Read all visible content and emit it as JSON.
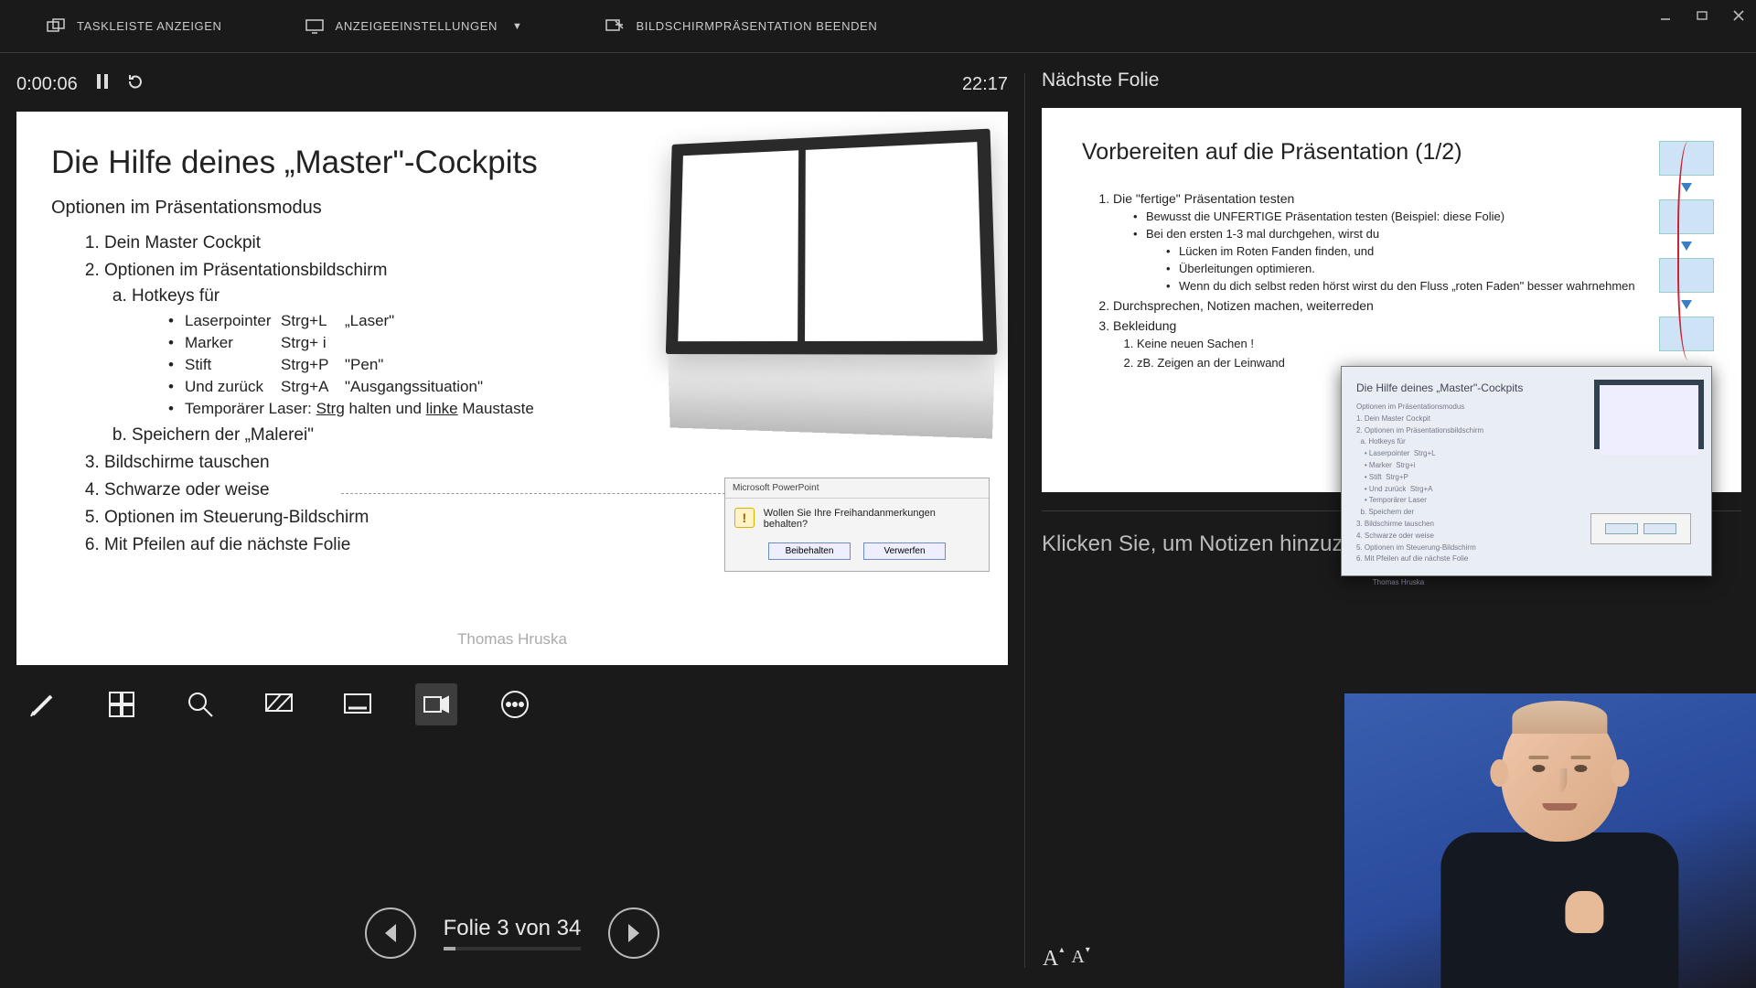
{
  "window": {
    "minimize": "—",
    "maximize": "❐",
    "close": "✕"
  },
  "topbar": {
    "taskbar": "TASKLEISTE ANZEIGEN",
    "display": "ANZEIGEEINSTELLUNGEN",
    "display_caret": "▼",
    "end": "BILDSCHIRMPRÄSENTATION BEENDEN"
  },
  "timer": {
    "elapsed": "0:00:06",
    "clock": "22:17"
  },
  "current_slide": {
    "title": "Die Hilfe deines „Master\"-Cockpits",
    "subtitle": "Optionen im Präsentationsmodus",
    "items": {
      "1": "Dein Master Cockpit",
      "2": "Optionen im Präsentationsbildschirm",
      "2a": "Hotkeys für",
      "hk1_a": "Laserpointer",
      "hk1_b": "Strg+L",
      "hk1_c": "„Laser\"",
      "hk2_a": "Marker",
      "hk2_b": "Strg+ i",
      "hk2_c": "",
      "hk3_a": "Stift",
      "hk3_b": "Strg+P",
      "hk3_c": "\"Pen\"",
      "hk4_a": "Und zurück",
      "hk4_b": "Strg+A",
      "hk4_c": "\"Ausgangssituation\"",
      "hk5_pre": "Temporärer Laser:  ",
      "hk5_u1": "Strg",
      "hk5_mid": " halten und ",
      "hk5_u2": "linke",
      "hk5_post": " Maustaste",
      "2b": "Speichern der „Malerei\"",
      "3": "Bildschirme tauschen",
      "4": "Schwarze oder weise",
      "5": "Optionen im Steuerung-Bildschirm",
      "6": "Mit Pfeilen auf die nächste Folie"
    },
    "author": "Thomas Hruska",
    "dialog": {
      "title": "Microsoft PowerPoint",
      "text": "Wollen Sie Ihre Freihandanmerkungen behalten?",
      "keep": "Beibehalten",
      "discard": "Verwerfen"
    }
  },
  "nav": {
    "label": "Folie 3 von 34",
    "current": 3,
    "total": 34
  },
  "next": {
    "label": "Nächste Folie",
    "title": "Vorbereiten auf die Präsentation (1/2)",
    "i1": "Die \"fertige\" Präsentation testen",
    "i1a": "Bewusst die UNFERTIGE Präsentation testen (Beispiel: diese Folie)",
    "i1b": "Bei den ersten 1-3 mal durchgehen, wirst du",
    "i1b1": "Lücken im Roten Fanden finden, und",
    "i1b2": "Überleitungen optimieren.",
    "i1b3": "Wenn du dich selbst reden hörst wirst du den Fluss „roten Faden\" besser wahrnehmen",
    "i2": "Durchsprechen, Notizen machen, weiterreden",
    "i3": "Bekleidung",
    "i3a": "Keine neuen Sachen !",
    "i3b": "zB. Zeigen an der Leinwand",
    "author": "Thomas Hruska"
  },
  "notes_placeholder": "Klicken Sie, um Notizen hinzuzufüge",
  "pip": {
    "title": "Die Hilfe deines „Master\"-Cockpits"
  }
}
